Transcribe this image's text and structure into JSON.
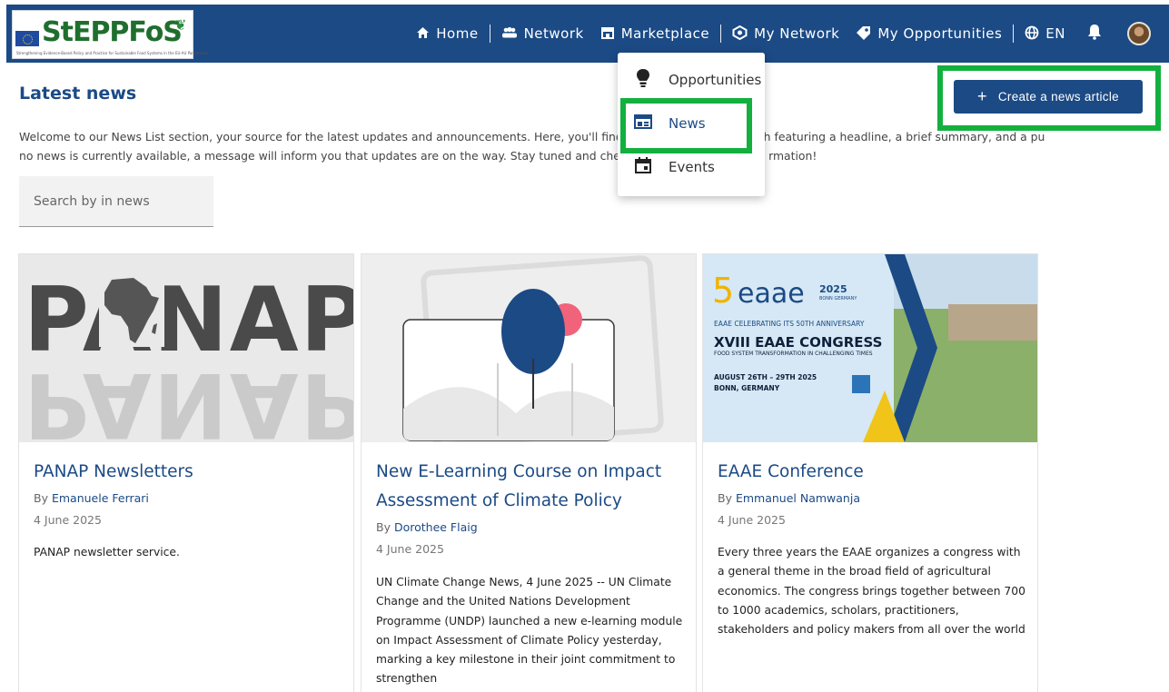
{
  "header": {
    "logo_text": "StEPPFoS",
    "logo_tagline": "Strengthening Evidence-Based Policy and Practice for Sustainable Food Systems in the EU-AU Partnership",
    "nav": {
      "home": "Home",
      "network": "Network",
      "marketplace": "Marketplace",
      "my_network": "My Network",
      "my_opportunities": "My Opportunities",
      "language": "EN"
    }
  },
  "marketplace_menu": {
    "items": [
      {
        "label": "Opportunities",
        "icon": "lightbulb-icon"
      },
      {
        "label": "News",
        "icon": "news-icon"
      },
      {
        "label": "Events",
        "icon": "calendar-icon"
      }
    ]
  },
  "main": {
    "title": "Latest news",
    "intro_line1": "Welcome to our News List section, your source for the latest updates and announcements. Here, you'll find a cu",
    "intro_line1_tail": "ch featuring a headline, a brief summary, and a publi",
    "intro_line2": "no news is currently available, a message will inform you that updates are on the way. Stay tuned and check bac",
    "intro_line2_tail": "rmation!",
    "search_placeholder": "Search by in news",
    "create_button": "Create a news article"
  },
  "cards": [
    {
      "title": "PANAP Newsletters",
      "by": "By",
      "author": "Emanuele Ferrari",
      "date": "4 June 2025",
      "description": "PANAP newsletter service.",
      "image_text": "PANAP"
    },
    {
      "title": "New E-Learning Course on Impact Assessment of Climate Policy",
      "by": "By",
      "author": "Dorothee Flaig",
      "date": "4 June 2025",
      "description": "UN Climate Change News, 4 June 2025 -- UN Climate Change and the United Nations Development Programme (UNDP) launched a new e-learning module on Impact Assessment of Climate Policy yesterday, marking a key milestone in their joint commitment to strengthen"
    },
    {
      "title": "EAAE Conference",
      "by": "By",
      "author": "Emmanuel Namwanja",
      "date": "4 June 2025",
      "description": "Every three years the EAAE organizes a congress with a general theme in the broad field of agricultural economics. The congress brings together between 700 to 1000 academics, scholars, practitioners, stakeholders and policy makers from all over the world",
      "image_text": {
        "logo": "eaae",
        "year": "2025",
        "location_small": "BONN GERMANY",
        "anniversary": "EAAE CELEBRATING ITS 50TH ANNIVERSARY",
        "congress": "XVIII EAAE CONGRESS",
        "subtitle": "FOOD SYSTEM TRANSFORMATION IN CHALLENGING TIMES",
        "dates": "AUGUST 26TH – 29TH 2025",
        "city": "BONN, GERMANY"
      }
    }
  ],
  "colors": {
    "brand_blue": "#1b4a85",
    "highlight_green": "#13b03e"
  }
}
